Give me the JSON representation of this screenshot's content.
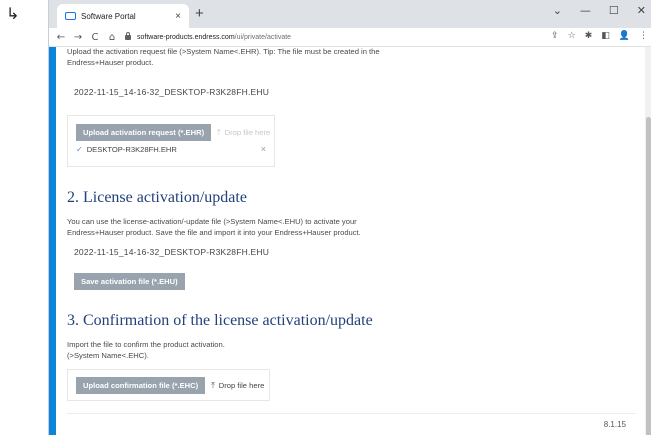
{
  "browser": {
    "tab_title": "Software Portal",
    "tab_close": "×",
    "new_tab": "+",
    "win_minimize": "—",
    "win_maximize": "☐",
    "win_close": "✕",
    "win_dropdown": "⌄",
    "nav_back": "←",
    "nav_forward": "→",
    "nav_reload": "C",
    "nav_home": "⌂",
    "url_host": "software-products.endress.com",
    "url_path": "/ui/private/activate",
    "icons": {
      "share": "⇪",
      "star": "☆",
      "extensions": "✱",
      "sidepanel": "◧",
      "profile": "👤",
      "menu": "⋮"
    }
  },
  "page": {
    "intro_text": "Upload the activation request file (>System Name<.EHR). Tip: The file must be created in the Endress+Hauser product.",
    "request_filename": "2022-11-15_14-16-32_DESKTOP-R3K28FH.EHU",
    "upload_request_button": "Upload activation request (*.EHR)",
    "drop_file_here_1": "Drop file here",
    "uploaded_file": "DESKTOP-R3K28FH.EHR",
    "remove_file": "×",
    "section2_title": "2. License activation/update",
    "section2_text": "You can use the license-activation/-update file (>System Name<.EHU) to activate your Endress+Hauser product. Save the file and import it into your Endress+Hauser product.",
    "activation_filename": "2022-11-15_14-16-32_DESKTOP-R3K28FH.EHU",
    "save_activation_button": "Save activation file (*.EHU)",
    "section3_title": "3. Confirmation of the license activation/update",
    "section3_text": "Import the file to confirm the product activation. (>System Name<.EHC).",
    "upload_confirmation_button": "Upload confirmation file (*.EHC)",
    "drop_file_here_2": "Drop file here",
    "version": "8.1.15"
  }
}
